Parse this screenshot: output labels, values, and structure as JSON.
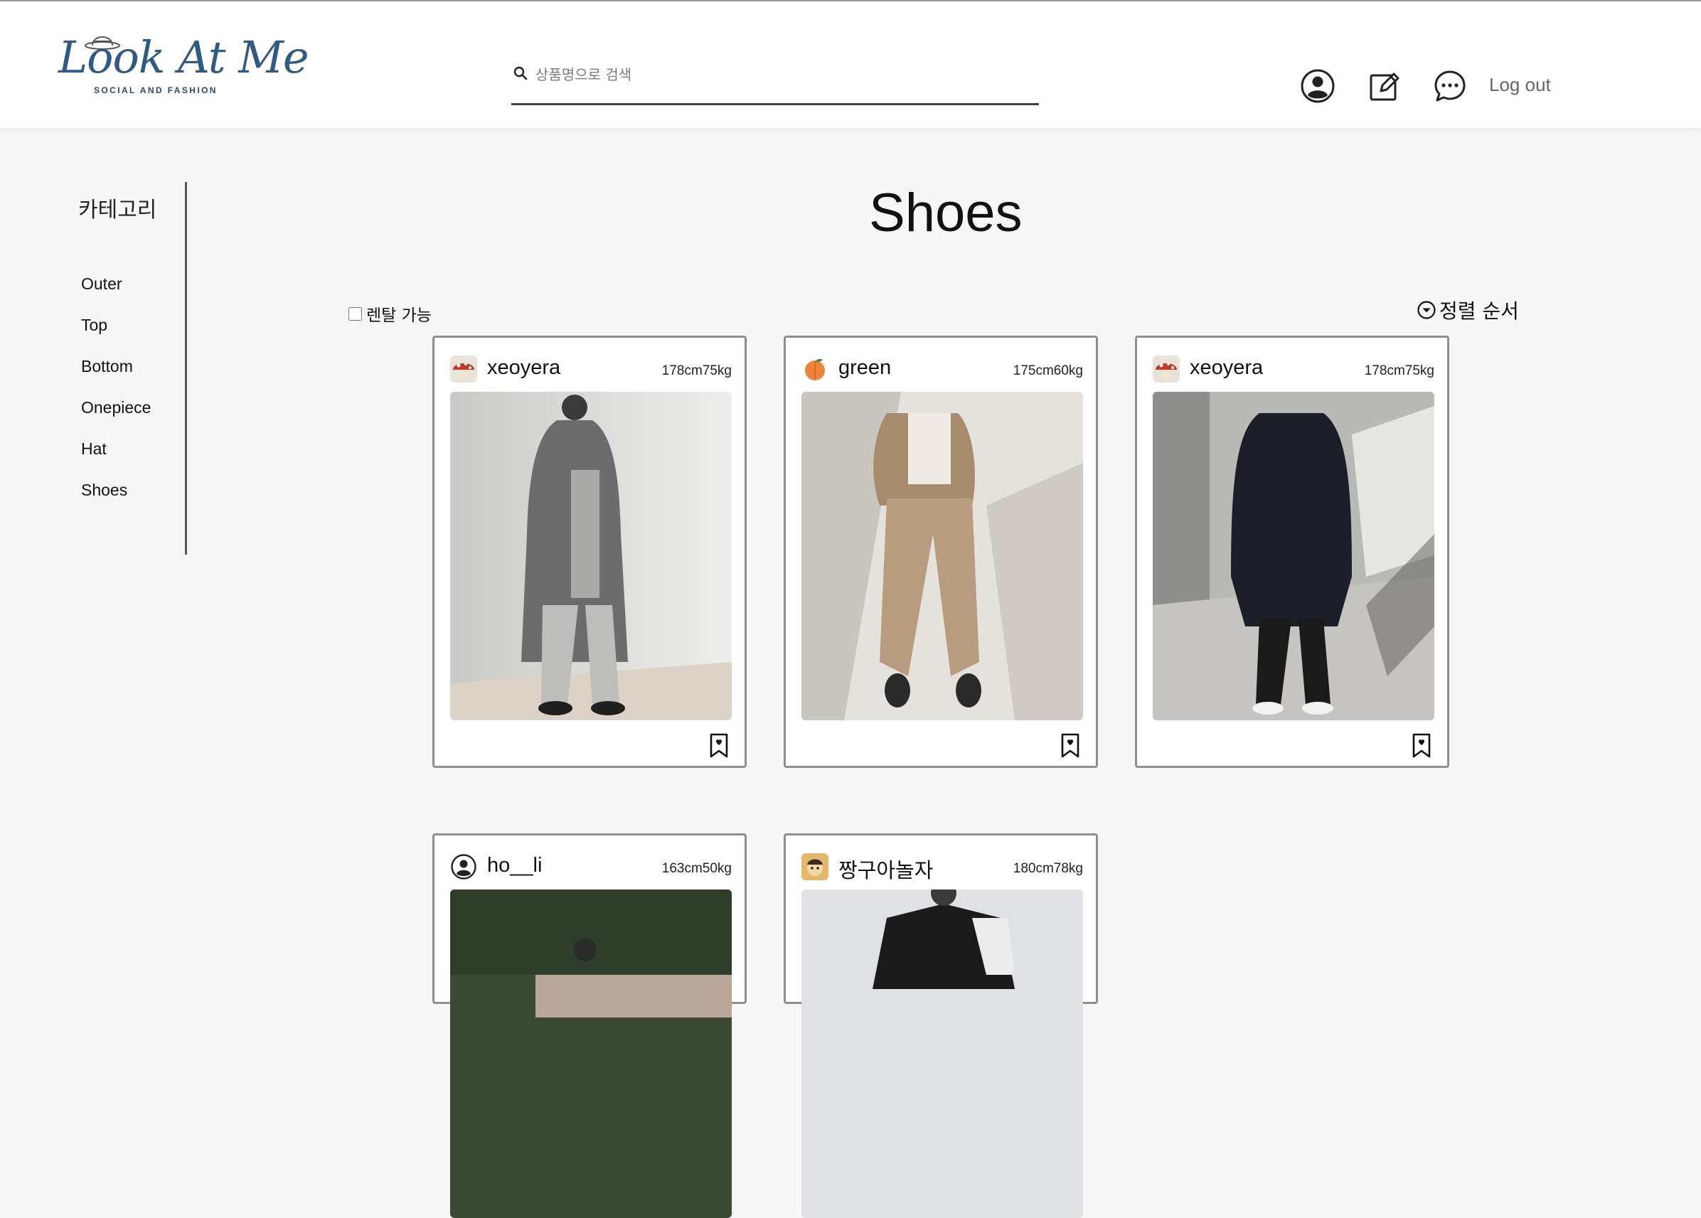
{
  "header": {
    "logo_text": "Look At Me",
    "logo_subtitle": "SOCIAL AND FASHION",
    "search_placeholder": "상품명으로 검색",
    "logout_label": "Log out",
    "icons": [
      "profile-icon",
      "edit-icon",
      "chat-icon"
    ]
  },
  "sidebar": {
    "title": "카테고리",
    "items": [
      {
        "label": "Outer"
      },
      {
        "label": "Top"
      },
      {
        "label": "Bottom"
      },
      {
        "label": "Onepiece"
      },
      {
        "label": "Hat"
      },
      {
        "label": "Shoes"
      }
    ]
  },
  "main": {
    "title": "Shoes",
    "rental_label": "렌탈 가능",
    "rental_checked": false,
    "sort_label": "정렬 순서"
  },
  "posts": [
    {
      "username": "xeoyera",
      "stats": "178cm75kg",
      "avatar": "mushroom-avatar",
      "photo": "grey coat outfit"
    },
    {
      "username": "green",
      "stats": "175cm60kg",
      "avatar": "peach-avatar",
      "photo": "beige blazer outfit"
    },
    {
      "username": "xeoyera",
      "stats": "178cm75kg",
      "avatar": "mushroom-avatar",
      "photo": "black coat outfit"
    },
    {
      "username": "ho__li",
      "stats": "163cm50kg",
      "avatar": "default-user-avatar",
      "photo": "outdoor outfit"
    },
    {
      "username": "짱구아놀자",
      "stats": "180cm78kg",
      "avatar": "character-avatar",
      "photo": "varsity jacket outfit"
    }
  ]
}
